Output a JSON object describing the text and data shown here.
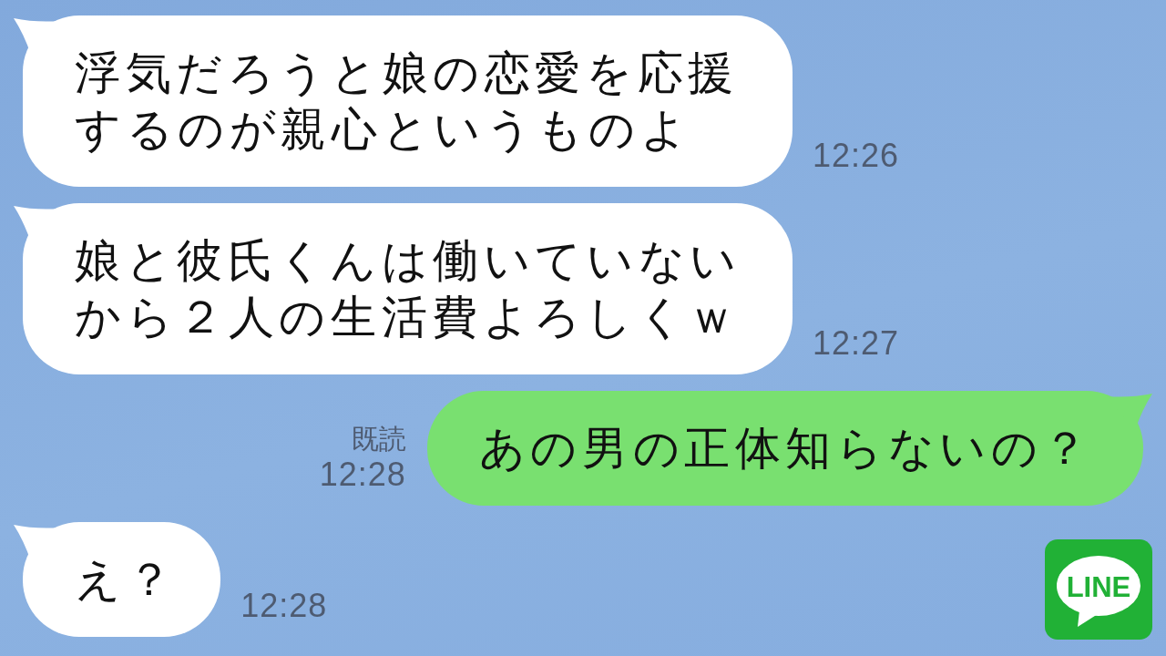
{
  "messages": [
    {
      "kind": "received",
      "text": "浮気だろうと娘の恋愛を応援するのが親心というものよ",
      "time": "12:26"
    },
    {
      "kind": "received",
      "text": "娘と彼氏くんは働いていないから２人の生活費よろしくｗ",
      "time": "12:27"
    },
    {
      "kind": "sent",
      "text": "あの男の正体知らないの？",
      "read_label": "既読",
      "time": "12:28"
    },
    {
      "kind": "received",
      "text": "え？",
      "time": "12:28"
    }
  ],
  "logo": {
    "text": "LINE"
  }
}
